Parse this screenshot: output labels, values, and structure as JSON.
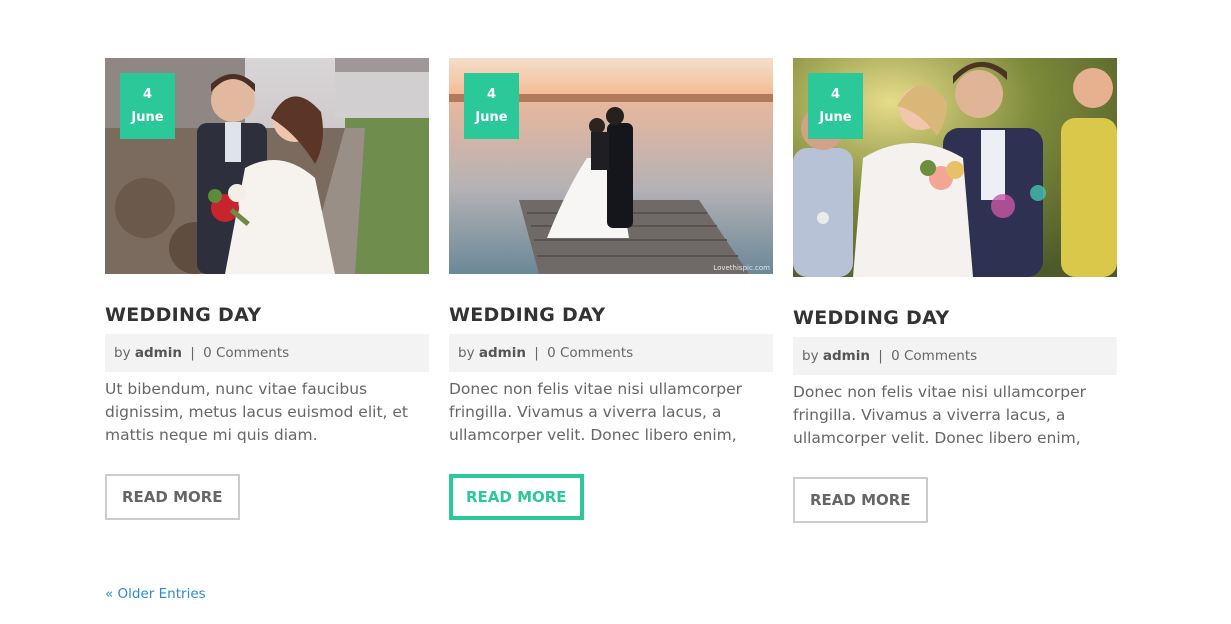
{
  "posts": [
    {
      "date_day": "4",
      "date_month": "June",
      "title": "WEDDING DAY",
      "by": "by",
      "author": "admin",
      "separator": "|",
      "comments": "0 Comments",
      "excerpt_lines": [
        "Ut bibendum, nunc vitae faucibus",
        "dignissim, metus lacus euismod elit, et",
        "mattis neque mi quis diam."
      ],
      "read_more": "READ MORE"
    },
    {
      "date_day": "4",
      "date_month": "June",
      "title": "WEDDING DAY",
      "by": "by",
      "author": "admin",
      "separator": "|",
      "comments": "0 Comments",
      "excerpt_lines": [
        "Donec non felis vitae nisi ullamcorper",
        "fringilla. Vivamus a viverra lacus, a",
        "ullamcorper velit. Donec libero enim,"
      ],
      "read_more": "READ MORE",
      "watermark": "Lovethispic.com"
    },
    {
      "date_day": "4",
      "date_month": "June",
      "title": "WEDDING DAY",
      "by": "by",
      "author": "admin",
      "separator": "|",
      "comments": "0 Comments",
      "excerpt_lines": [
        "Donec non felis vitae nisi ullamcorper",
        "fringilla. Vivamus a viverra lacus, a",
        "ullamcorper velit. Donec libero enim,"
      ],
      "read_more": "READ MORE"
    }
  ],
  "pagination": {
    "older": "« Older Entries"
  },
  "colors": {
    "accent": "#2bc99a",
    "link": "#2a8bd0",
    "text": "#666666",
    "title": "#333333"
  }
}
